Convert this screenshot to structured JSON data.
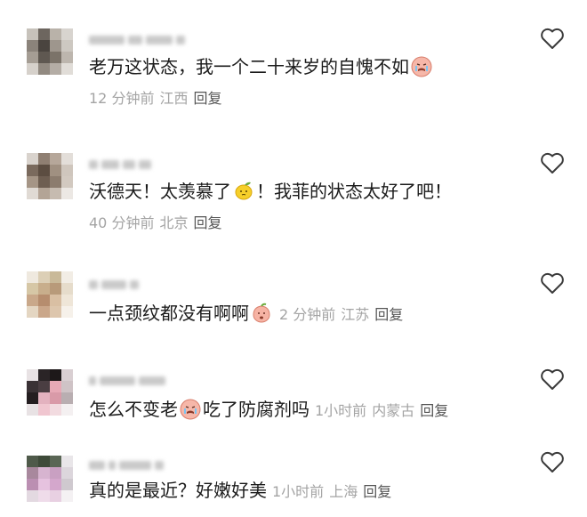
{
  "comments": [
    {
      "text": "老万这状态，我一个二十来岁的自愧不如",
      "emoji": "crying-face-icon",
      "time": "12 分钟前",
      "location": "江西",
      "reply_label": "回复"
    },
    {
      "text_before": "沃德天！太羡慕了",
      "emoji": "lemon-icon",
      "text_after": "！我菲的状态太好了吧！",
      "time": "40 分钟前",
      "location": "北京",
      "reply_label": "回复"
    },
    {
      "text": "一点颈纹都没有啊啊",
      "emoji": "peach-face-icon",
      "time": "2 分钟前",
      "location": "江苏",
      "reply_label": "回复"
    },
    {
      "text_before": "怎么不变老",
      "emoji": "crying-face-icon",
      "text_after": "吃了防腐剂吗",
      "time": "1小时前",
      "location": "内蒙古",
      "reply_label": "回复"
    },
    {
      "text": "真的是最近？好嫩好美",
      "time": "1小时前",
      "location": "上海",
      "reply_label": "回复"
    }
  ],
  "colors": {
    "text": "#1b1b1b",
    "meta": "#a4a4a4",
    "reply": "#555555",
    "heart_stroke": "#3a3a3a"
  }
}
